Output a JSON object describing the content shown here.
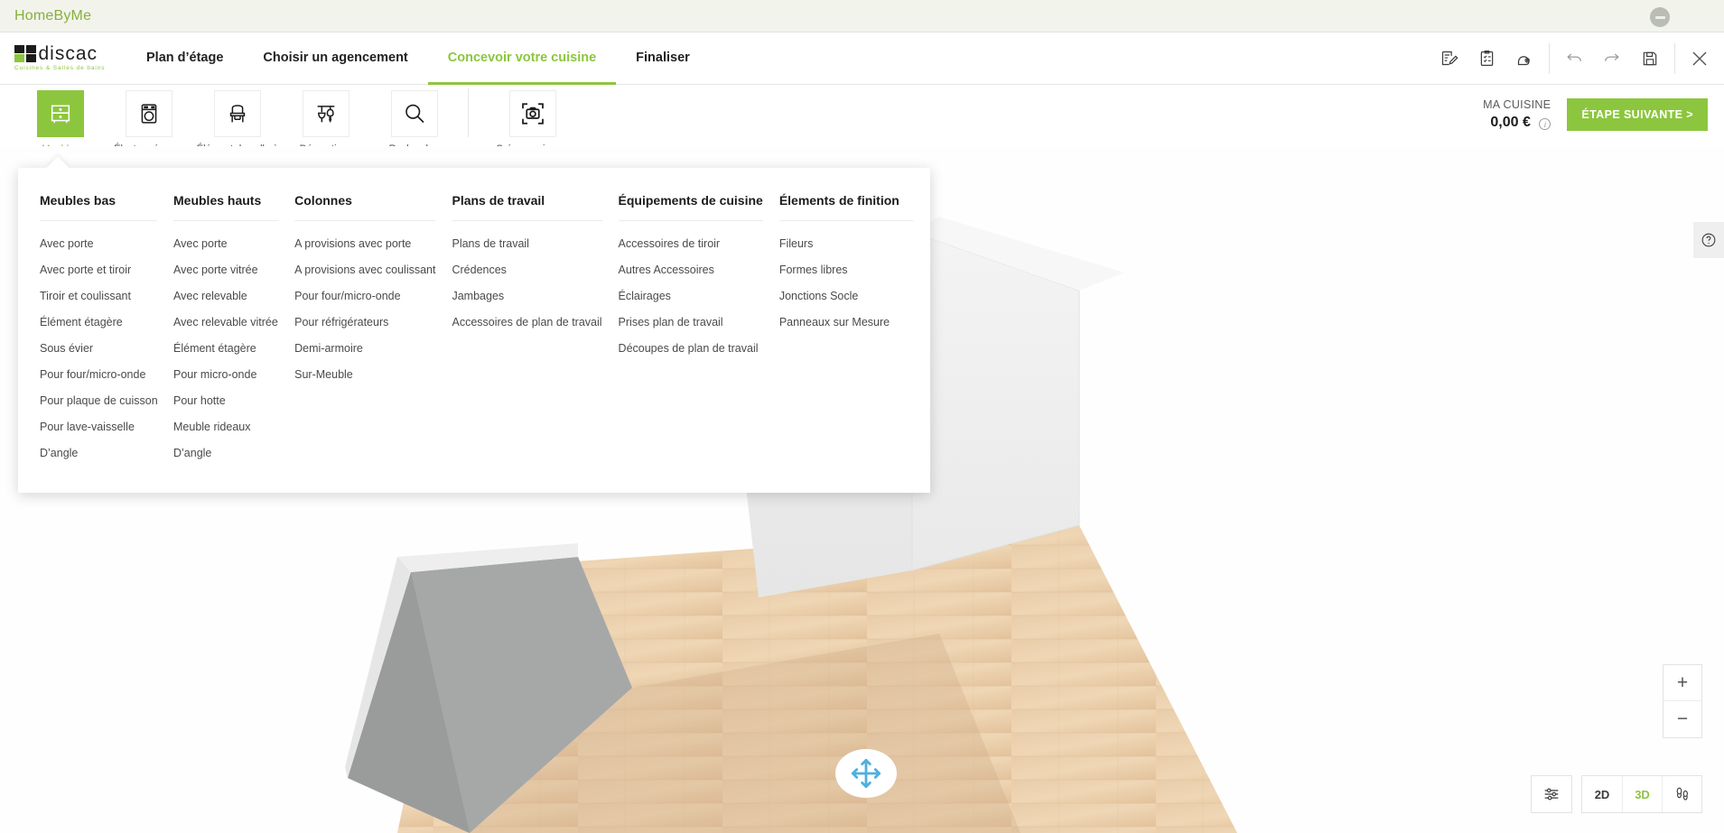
{
  "window": {
    "title": "HomeByMe",
    "minimize_icon": "minimize-icon"
  },
  "brand": {
    "name": "discac",
    "tagline": "Cuisines & Salles de bains"
  },
  "nav": {
    "tabs": [
      {
        "label": "Plan d’étage",
        "active": false
      },
      {
        "label": "Choisir un agencement",
        "active": false
      },
      {
        "label": "Concevoir votre cuisine",
        "active": true
      },
      {
        "label": "Finaliser",
        "active": false
      }
    ],
    "icons": [
      {
        "name": "note-edit-icon"
      },
      {
        "name": "clipboard-checklist-icon"
      },
      {
        "name": "measuring-tape-icon"
      },
      {
        "name": "undo-icon"
      },
      {
        "name": "redo-icon"
      },
      {
        "name": "save-icon"
      },
      {
        "name": "close-icon"
      }
    ]
  },
  "toolbar": {
    "items": [
      {
        "label": "Meubles",
        "icon": "cabinet-icon",
        "active": true
      },
      {
        "label": "Électroménager",
        "icon": "washing-machine-icon",
        "active": false
      },
      {
        "label": "Élément de salle à manger",
        "icon": "chair-icon",
        "active": false
      },
      {
        "label": "Décorations",
        "icon": "utensils-icon",
        "active": false
      },
      {
        "label": "Rechercher",
        "icon": "search-icon",
        "active": false
      },
      {
        "label": "Créer une image",
        "icon": "camera-icon",
        "active": false
      }
    ],
    "price_label": "MA CUISINE",
    "price_value": "0,00 €",
    "info_icon": "info-icon",
    "next_button": "ÉTAPE SUIVANTE >"
  },
  "mega_menu": {
    "columns": [
      {
        "title": "Meubles bas",
        "items": [
          "Avec porte",
          "Avec porte et tiroir",
          "Tiroir et coulissant",
          "Élément étagère",
          "Sous évier",
          "Pour four/micro-onde",
          "Pour plaque de cuisson",
          "Pour lave-vaisselle",
          "D’angle"
        ]
      },
      {
        "title": "Meubles hauts",
        "items": [
          "Avec porte",
          "Avec porte vitrée",
          "Avec relevable",
          "Avec relevable vitrée",
          "Élément étagère",
          "Pour micro-onde",
          "Pour hotte",
          "Meuble rideaux",
          "D’angle"
        ]
      },
      {
        "title": "Colonnes",
        "items": [
          "A provisions avec porte",
          "A provisions avec coulissant",
          "Pour four/micro-onde",
          "Pour réfrigérateurs",
          "Demi-armoire",
          "Sur-Meuble"
        ]
      },
      {
        "title": "Plans de travail",
        "items": [
          "Plans de travail",
          "Crédences",
          "Jambages",
          "Accessoires de plan de travail"
        ]
      },
      {
        "title": "Équipements de cuisine",
        "items": [
          "Accessoires de tiroir",
          "Autres Accessoires",
          "Éclairages",
          "Prises plan de travail",
          "Découpes de plan de travail"
        ]
      },
      {
        "title": "Élements de finition",
        "items": [
          "Fileurs",
          "Formes libres",
          "Jonctions Socle",
          "Panneaux sur Mesure"
        ]
      }
    ]
  },
  "viewport": {
    "help_icon": "question-mark-icon",
    "gizmo_icon": "move-arrows-icon",
    "zoom_in": "+",
    "zoom_out": "−",
    "settings_icon": "sliders-icon",
    "view_2d": "2D",
    "view_3d": "3D",
    "walkthrough_icon": "footsteps-icon",
    "active_view": "3D"
  },
  "colors": {
    "accent": "#8cc63e",
    "gizmo_blue": "#4db0e0",
    "topstrip_bg": "#f2f4ec",
    "floor_wood": "#e5c7a4",
    "wall_white": "#efefef"
  }
}
